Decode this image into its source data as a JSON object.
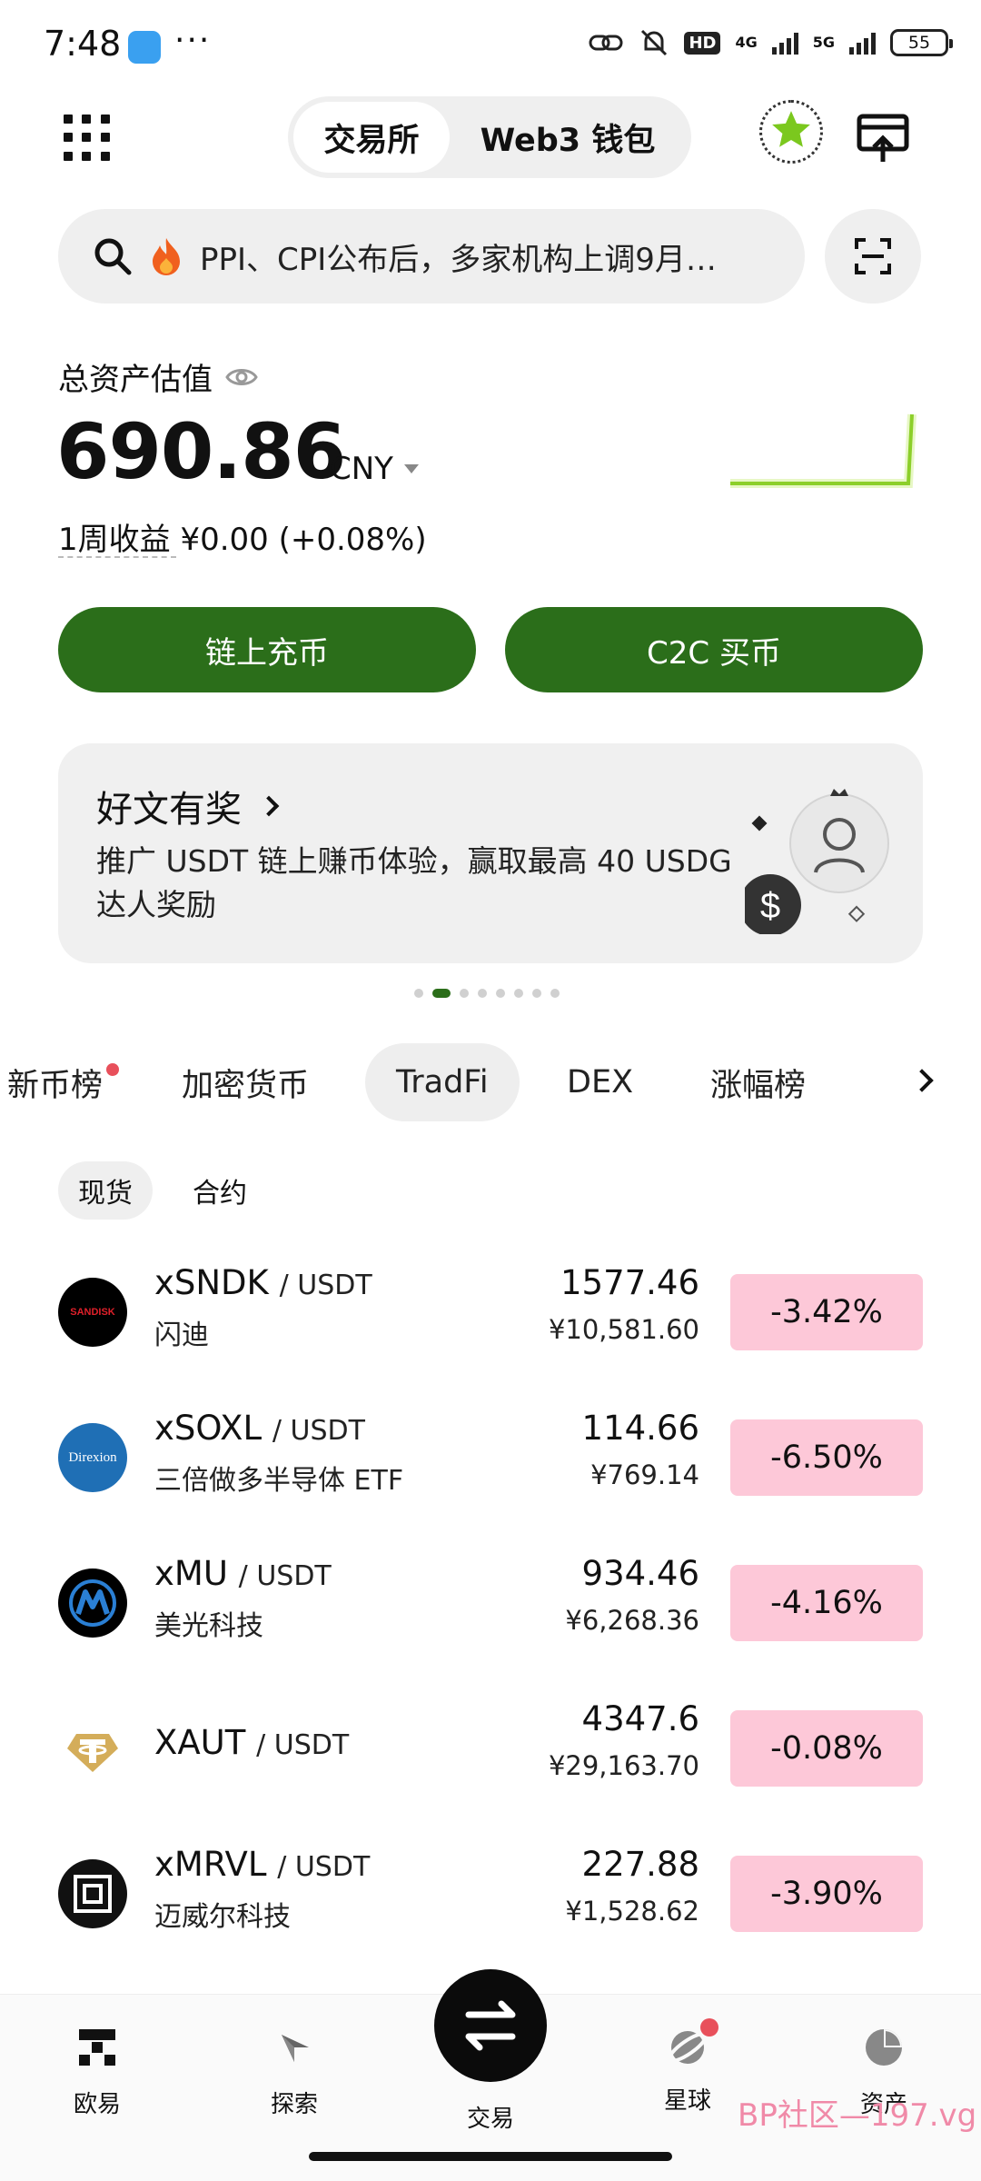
{
  "status_bar": {
    "time": "7:48",
    "dots": "···",
    "hd": "HD",
    "net1": "4G",
    "net2": "5G",
    "battery": "55"
  },
  "header": {
    "tab_exchange": "交易所",
    "tab_web3": "Web3 钱包"
  },
  "search": {
    "text": "PPI、CPI公布后，多家机构上调9月…"
  },
  "assets": {
    "label": "总资产估值",
    "value": "690.86",
    "currency": "CNY",
    "weekly": "1周收益 ¥0.00 (+0.08%)"
  },
  "buttons": {
    "deposit": "链上充币",
    "c2c": "C2C 买币"
  },
  "promo": {
    "title": "好文有奖",
    "body": "推广 USDT 链上赚币体验，赢取最高 40 USDG 达人奖励"
  },
  "pager": {
    "count": 8,
    "active": 1
  },
  "market_tabs": [
    "新币榜",
    "加密货币",
    "TradFi",
    "DEX",
    "涨幅榜"
  ],
  "market_active": "TradFi",
  "sub_tabs": {
    "spot": "现货",
    "futures": "合约"
  },
  "rows": [
    {
      "base": "xSNDK",
      "quote": "/ USDT",
      "name": "闪迪",
      "price": "1577.46",
      "cny": "¥10,581.60",
      "change": "-3.42%"
    },
    {
      "base": "xSOXL",
      "quote": "/ USDT",
      "name": "三倍做多半导体 ETF",
      "price": "114.66",
      "cny": "¥769.14",
      "change": "-6.50%"
    },
    {
      "base": "xMU",
      "quote": "/ USDT",
      "name": "美光科技",
      "price": "934.46",
      "cny": "¥6,268.36",
      "change": "-4.16%"
    },
    {
      "base": "XAUT",
      "quote": "/ USDT",
      "name": "",
      "price": "4347.6",
      "cny": "¥29,163.70",
      "change": "-0.08%"
    },
    {
      "base": "xMRVL",
      "quote": "/ USDT",
      "name": "迈威尔科技",
      "price": "227.88",
      "cny": "¥1,528.62",
      "change": "-3.90%"
    }
  ],
  "logos": {
    "sndk_text": "SANDISK",
    "soxl_text": "Direxion"
  },
  "bottom_nav": {
    "home": "欧易",
    "explore": "探索",
    "trade": "交易",
    "planet": "星球",
    "assets": "资产"
  },
  "watermark": "BP社区—197.vg",
  "colors": {
    "accent": "#2b6e1a",
    "negative_bg": "#fdc8d8",
    "dot": "#e8505b"
  }
}
